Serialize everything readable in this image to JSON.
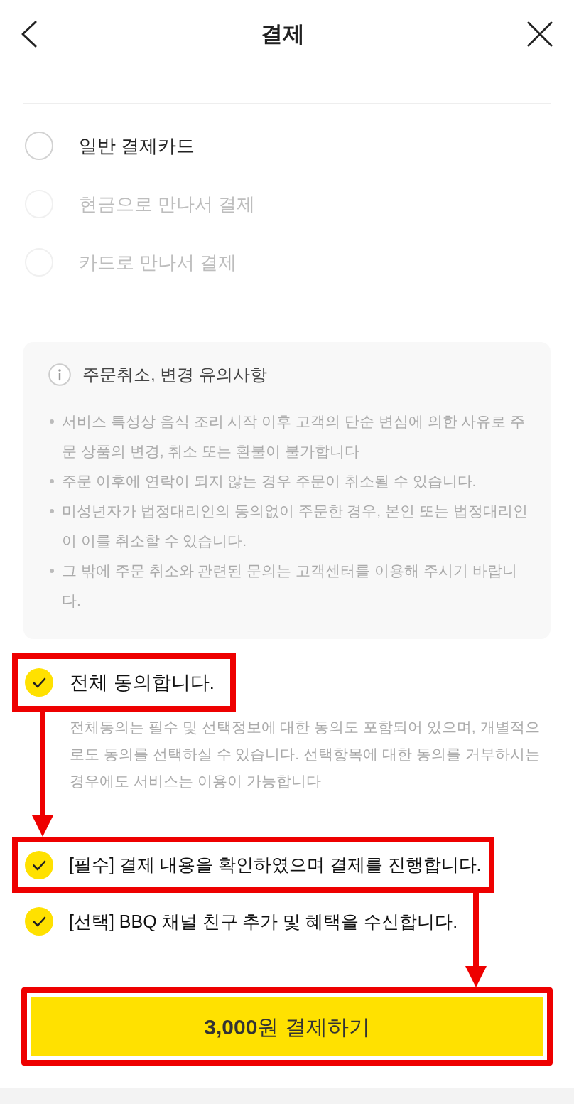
{
  "header": {
    "title": "결제"
  },
  "payment_methods": [
    {
      "label": "일반 결제카드",
      "selected": false,
      "disabled": false
    },
    {
      "label": "현금으로 만나서 결제",
      "selected": false,
      "disabled": true
    },
    {
      "label": "카드로 만나서 결제",
      "selected": false,
      "disabled": true
    }
  ],
  "notice": {
    "title": "주문취소, 변경 유의사항",
    "items": [
      "서비스 특성상 음식 조리 시작 이후 고객의 단순 변심에 의한 사유로 주문 상품의 변경, 취소 또는 환불이 불가합니다",
      "주문 이후에 연락이 되지 않는 경우 주문이 취소될 수 있습니다.",
      "미성년자가 법정대리인의 동의없이 주문한 경우, 본인 또는 법정대리인이 이를 취소할 수 있습니다.",
      "그 밖에 주문 취소와 관련된 문의는 고객센터를 이용해 주시기 바랍니다."
    ]
  },
  "agree_all": {
    "label": "전체 동의합니다.",
    "checked": true,
    "highlighted": true,
    "description": "전체동의는 필수 및 선택정보에 대한 동의도 포함되어 있으며, 개별적으로도 동의를 선택하실 수 있습니다. 선택항목에 대한 동의를 거부하시는 경우에도 서비스는 이용이 가능합니다"
  },
  "agreements": [
    {
      "label": "[필수] 결제 내용을 확인하였으며 결제를 진행합니다.",
      "checked": true,
      "highlighted": true
    },
    {
      "label": "[선택] BBQ 채널 친구 추가 및 혜택을 수신합니다.",
      "checked": true,
      "highlighted": false
    }
  ],
  "pay_button": {
    "label": "**3,000**원 결제하기",
    "highlighted": true
  }
}
